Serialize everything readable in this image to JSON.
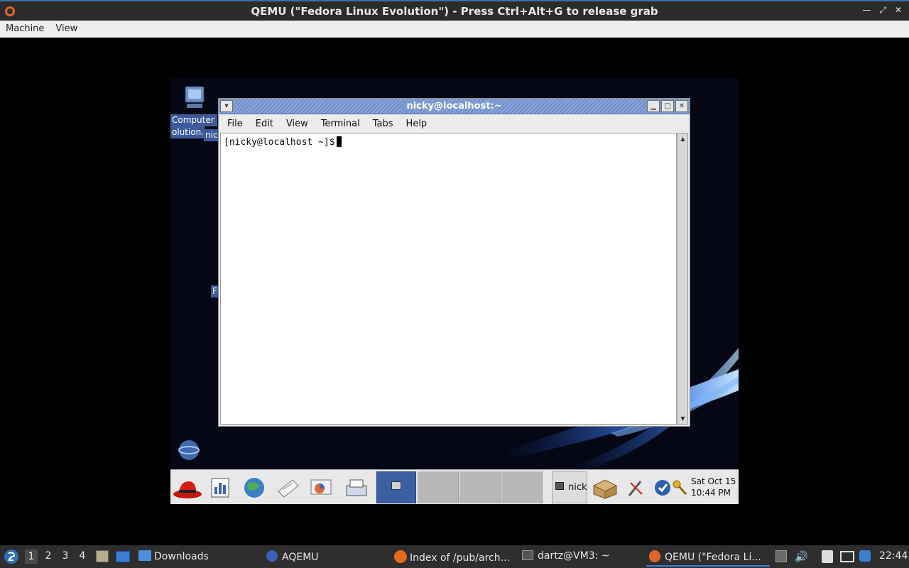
{
  "host": {
    "window_title": "QEMU (\"Fedora Linux Evolution\") - Press Ctrl+Alt+G to release grab",
    "menu": [
      "Machine",
      "View"
    ]
  },
  "guest": {
    "desktop_icons": [
      {
        "label_line1": "Computer :",
        "label_line2": "olution.s"
      },
      {
        "label": "nic"
      },
      {
        "label": "F"
      }
    ],
    "terminal": {
      "title": "nicky@localhost:~",
      "menu": [
        "File",
        "Edit",
        "View",
        "Terminal",
        "Tabs",
        "Help"
      ],
      "prompt": "[nicky@localhost ~]$"
    },
    "panel": {
      "task_label": "nick",
      "clock_day": "Sat Oct 15",
      "clock_time": "10:44 PM"
    }
  },
  "taskbar": {
    "workspaces": [
      "1",
      "2",
      "3",
      "4"
    ],
    "items": [
      "Downloads",
      "AQEMU",
      "Index of /pub/arch...",
      "dartz@VM3: ~",
      "QEMU (\"Fedora Li..."
    ],
    "clock": "22:44"
  }
}
